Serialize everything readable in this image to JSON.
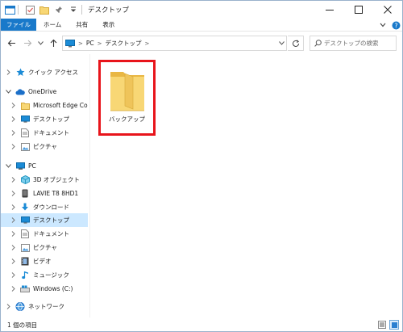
{
  "window": {
    "title": "デスクトップ",
    "controls": {
      "minimize": "—",
      "maximize": "☐",
      "close": "✕"
    }
  },
  "ribbon": {
    "tabs": [
      "ファイル",
      "ホーム",
      "共有",
      "表示"
    ]
  },
  "address": {
    "crumbs": [
      "PC",
      "デスクトップ"
    ],
    "search_placeholder": "デスクトップの検索"
  },
  "nav": {
    "items": [
      {
        "label": "クイック アクセス",
        "icon": "star-icon",
        "level": 0,
        "expand": "collapsed"
      },
      {
        "label": "OneDrive",
        "icon": "cloud-icon",
        "level": 0,
        "expand": "expanded"
      },
      {
        "label": "Microsoft Edge Co",
        "icon": "folder-icon",
        "level": 1,
        "expand": "collapsed"
      },
      {
        "label": "デスクトップ",
        "icon": "desktop-icon",
        "level": 1,
        "expand": "collapsed"
      },
      {
        "label": "ドキュメント",
        "icon": "document-icon",
        "level": 1,
        "expand": "collapsed"
      },
      {
        "label": "ピクチャ",
        "icon": "picture-icon",
        "level": 1,
        "expand": "collapsed"
      },
      {
        "label": "PC",
        "icon": "pc-icon",
        "level": 0,
        "expand": "expanded"
      },
      {
        "label": "3D オブジェクト",
        "icon": "cube-icon",
        "level": 1,
        "expand": "collapsed"
      },
      {
        "label": "LAVIE T8 8HD1",
        "icon": "device-icon",
        "level": 1,
        "expand": "collapsed"
      },
      {
        "label": "ダウンロード",
        "icon": "download-icon",
        "level": 1,
        "expand": "collapsed"
      },
      {
        "label": "デスクトップ",
        "icon": "desktop-icon",
        "level": 1,
        "expand": "collapsed",
        "selected": true
      },
      {
        "label": "ドキュメント",
        "icon": "document-icon",
        "level": 1,
        "expand": "collapsed"
      },
      {
        "label": "ピクチャ",
        "icon": "picture-icon",
        "level": 1,
        "expand": "collapsed"
      },
      {
        "label": "ビデオ",
        "icon": "video-icon",
        "level": 1,
        "expand": "collapsed"
      },
      {
        "label": "ミュージック",
        "icon": "music-icon",
        "level": 1,
        "expand": "collapsed"
      },
      {
        "label": "Windows (C:)",
        "icon": "drive-icon",
        "level": 1,
        "expand": "collapsed"
      },
      {
        "label": "ネットワーク",
        "icon": "network-icon",
        "level": 0,
        "expand": "collapsed"
      }
    ]
  },
  "content": {
    "items": [
      {
        "label": "バックアップ",
        "icon": "folder-icon",
        "highlighted": true
      }
    ]
  },
  "status": {
    "text": "1 個の項目"
  },
  "colors": {
    "accent": "#1979ca",
    "selection": "#cce8ff",
    "highlight_border": "#e8141b",
    "folder": "#f8d775"
  }
}
